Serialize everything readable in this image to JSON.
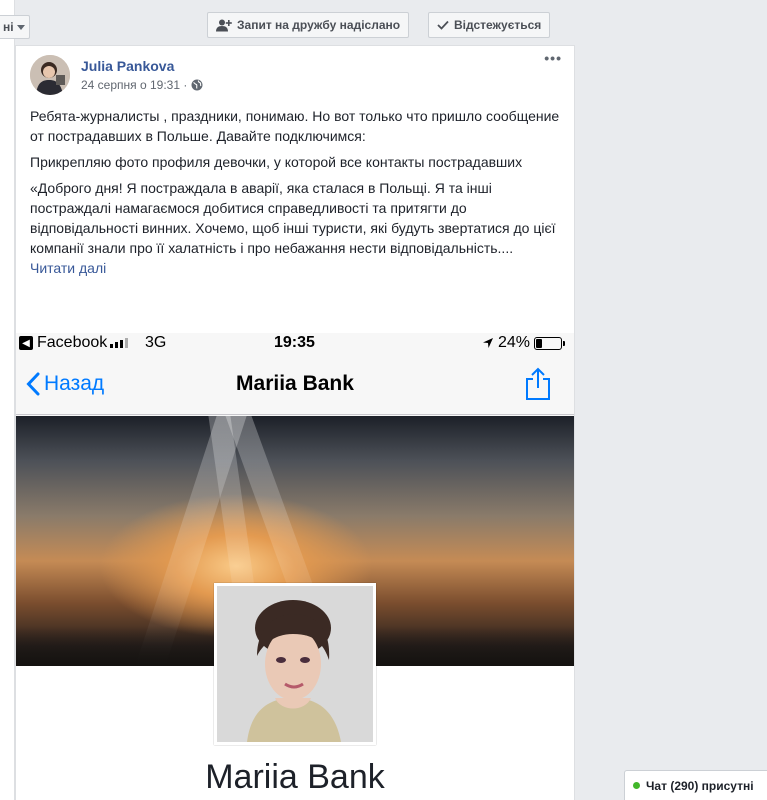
{
  "left_menu": {
    "label": "ні"
  },
  "profile_actions": {
    "friend_request_label": "Запит на дружбу надіслано",
    "follow_label": "Відстежується"
  },
  "post": {
    "author": "Julia Pankova",
    "date": "24 серпня о 19:31 ·",
    "more": "•••",
    "paragraphs": [
      "Ребята-журналисты , праздники, понимаю. Но вот только что пришло сообщение от пострадавших в Польше. Давайте подключимся:",
      "Прикрепляю фото профиля девочки, у которой все контакты пострадавших",
      "«Доброго дня! Я постраждала в аварії, яка сталася в Польщі. Я та інші постраждалі намагаємося добитися справедливості та притягти до відповідальності винних. Хочемо, щоб інші туристи, які будуть звертатися до цієї компанії знали про її халатність і про небажання нести відповідальність...."
    ],
    "see_more": "Читати далі"
  },
  "phone": {
    "app": "Facebook",
    "network": "3G",
    "time": "19:35",
    "battery": "24%",
    "battery_level": 0.24,
    "back_label": "Назад",
    "nav_title": "Mariia Bank",
    "profile_name": "Mariia Bank"
  },
  "chat": {
    "label": "Чат (290) присутні"
  },
  "colors": {
    "link": "#385898",
    "ios_blue": "#007aff",
    "online": "#42b72a"
  }
}
